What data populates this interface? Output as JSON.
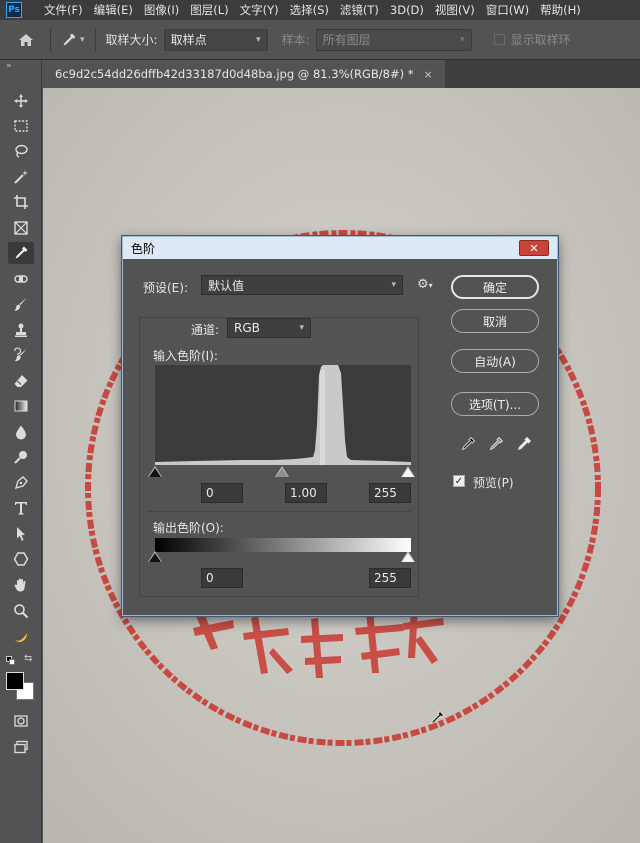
{
  "menubar": {
    "logo": "Ps",
    "items": [
      "文件(F)",
      "编辑(E)",
      "图像(I)",
      "图层(L)",
      "文字(Y)",
      "选择(S)",
      "滤镜(T)",
      "3D(D)",
      "视图(V)",
      "窗口(W)",
      "帮助(H)"
    ]
  },
  "options": {
    "sample_size_label": "取样大小:",
    "sample_size_value": "取样点",
    "sample_label": "样本:",
    "sample_value": "所有图层",
    "show_ring_label": "显示取样环"
  },
  "document": {
    "tab_title": "6c9d2c54dd26dffb42d33187d0d48ba.jpg @ 81.3%(RGB/8#) *",
    "close_glyph": "×"
  },
  "dialog": {
    "title": "色阶",
    "close_glyph": "✕",
    "preset_label": "预设(E):",
    "preset_value": "默认值",
    "channel_label": "通道:",
    "channel_value": "RGB",
    "input_levels_label": "输入色阶(I):",
    "input_black": "0",
    "input_gamma": "1.00",
    "input_white": "255",
    "output_levels_label": "输出色阶(O):",
    "output_black": "0",
    "output_white": "255",
    "buttons": {
      "ok": "确定",
      "cancel": "取消",
      "auto": "自动(A)",
      "options": "选项(T)..."
    },
    "preview_label": "预览(P)",
    "preview_checked": true
  },
  "canvas": {
    "stamp_text": "专存直属"
  },
  "colors": {
    "foreground": "#000000",
    "background": "#ffffff",
    "stamp_red": "#c8342c",
    "paper": "#d2cfc9"
  }
}
